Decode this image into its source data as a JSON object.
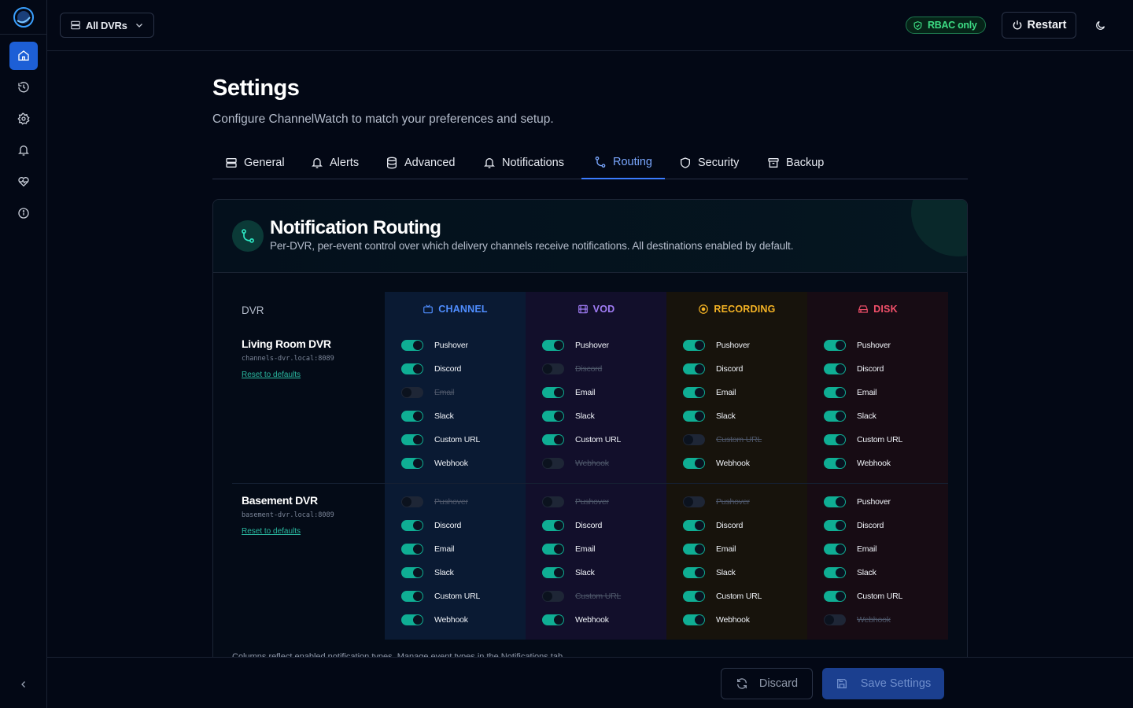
{
  "sidebar": {
    "logo": "app-logo",
    "items": [
      {
        "name": "home",
        "icon": "home-icon",
        "active": true
      },
      {
        "name": "history",
        "icon": "history-icon"
      },
      {
        "name": "settings",
        "icon": "gear-icon"
      },
      {
        "name": "alerts",
        "icon": "bell-icon"
      },
      {
        "name": "health",
        "icon": "heart-pulse-icon"
      },
      {
        "name": "about",
        "icon": "info-icon"
      }
    ],
    "collapse_icon": "chevron-left-icon"
  },
  "topbar": {
    "dvr_select": "All DVRs",
    "rbac_badge": "RBAC only",
    "restart_label": "Restart",
    "theme_icon": "moon-icon"
  },
  "page": {
    "title": "Settings",
    "subtitle": "Configure ChannelWatch to match your preferences and setup."
  },
  "tabs": [
    {
      "label": "General",
      "icon": "server-icon"
    },
    {
      "label": "Alerts",
      "icon": "bell-icon"
    },
    {
      "label": "Advanced",
      "icon": "database-icon"
    },
    {
      "label": "Notifications",
      "icon": "bell-icon"
    },
    {
      "label": "Routing",
      "icon": "route-icon",
      "active": true
    },
    {
      "label": "Security",
      "icon": "shield-icon"
    },
    {
      "label": "Backup",
      "icon": "archive-icon"
    }
  ],
  "routing": {
    "title": "Notification Routing",
    "description": "Per-DVR, per-event control over which delivery channels receive notifications. All destinations enabled by default.",
    "dvr_header": "DVR",
    "columns": [
      {
        "key": "channel",
        "label": "CHANNEL",
        "icon": "tv-icon",
        "color": "#4f8dff"
      },
      {
        "key": "vod",
        "label": "VOD",
        "icon": "film-icon",
        "color": "#a07cf5"
      },
      {
        "key": "recording",
        "label": "RECORDING",
        "icon": "record-icon",
        "color": "#f5b324"
      },
      {
        "key": "disk",
        "label": "DISK",
        "icon": "hard-drive-icon",
        "color": "#f2506a"
      }
    ],
    "destinations": [
      "Pushover",
      "Discord",
      "Email",
      "Slack",
      "Custom URL",
      "Webhook"
    ],
    "reset_label": "Reset to defaults",
    "dvrs": [
      {
        "name": "Living Room DVR",
        "host": "channels-dvr.local:8089",
        "toggles": {
          "channel": [
            true,
            true,
            false,
            true,
            true,
            true
          ],
          "vod": [
            true,
            false,
            true,
            true,
            true,
            false
          ],
          "recording": [
            true,
            true,
            true,
            true,
            false,
            true
          ],
          "disk": [
            true,
            true,
            true,
            true,
            true,
            true
          ]
        }
      },
      {
        "name": "Basement DVR",
        "host": "basement-dvr.local:8089",
        "toggles": {
          "channel": [
            false,
            true,
            true,
            true,
            true,
            true
          ],
          "vod": [
            false,
            true,
            true,
            true,
            false,
            true
          ],
          "recording": [
            false,
            true,
            true,
            true,
            true,
            true
          ],
          "disk": [
            true,
            true,
            true,
            true,
            true,
            false
          ]
        }
      }
    ],
    "footer_note": "Columns reflect enabled notification types. Manage event types in the Notifications tab."
  },
  "actions": {
    "discard_label": "Discard",
    "save_label": "Save Settings"
  },
  "colors": {
    "accent": "#1d5fd6",
    "toggle_on": "#0fae94",
    "toggle_off": "#1e2636"
  }
}
